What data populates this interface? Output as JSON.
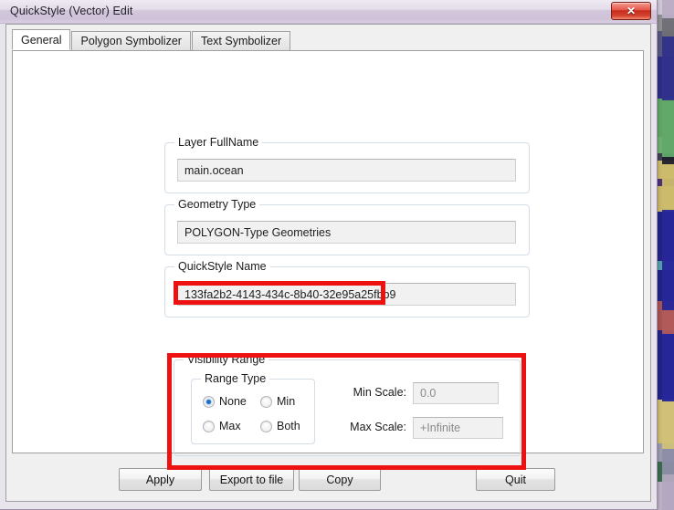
{
  "window": {
    "title": "QuickStyle (Vector) Edit",
    "close_label": "✕"
  },
  "tabs": [
    {
      "label": "General",
      "active": true
    },
    {
      "label": "Polygon Symbolizer",
      "active": false
    },
    {
      "label": "Text Symbolizer",
      "active": false
    }
  ],
  "general": {
    "layer_fullname": {
      "group_title": "Layer FullName",
      "value": "main.ocean"
    },
    "geometry_type": {
      "group_title": "Geometry Type",
      "value": "POLYGON-Type Geometries"
    },
    "quickstyle_name": {
      "group_title": "QuickStyle Name",
      "value": "133fa2b2-4143-434c-8b40-32e95a25fbb9"
    },
    "visibility_range": {
      "group_title": "Visibility Range",
      "range_type": {
        "group_title": "Range Type",
        "options": [
          {
            "label": "None",
            "checked": true
          },
          {
            "label": "Min",
            "checked": false
          },
          {
            "label": "Max",
            "checked": false
          },
          {
            "label": "Both",
            "checked": false
          }
        ]
      },
      "min_scale": {
        "label": "Min Scale:",
        "value": "0.0"
      },
      "max_scale": {
        "label": "Max Scale:",
        "value": "+Infinite"
      }
    }
  },
  "buttons": {
    "apply": "Apply",
    "export": "Export to file",
    "copy": "Copy",
    "quit": "Quit"
  },
  "annotations": {
    "accent_color": "#ee1111"
  }
}
